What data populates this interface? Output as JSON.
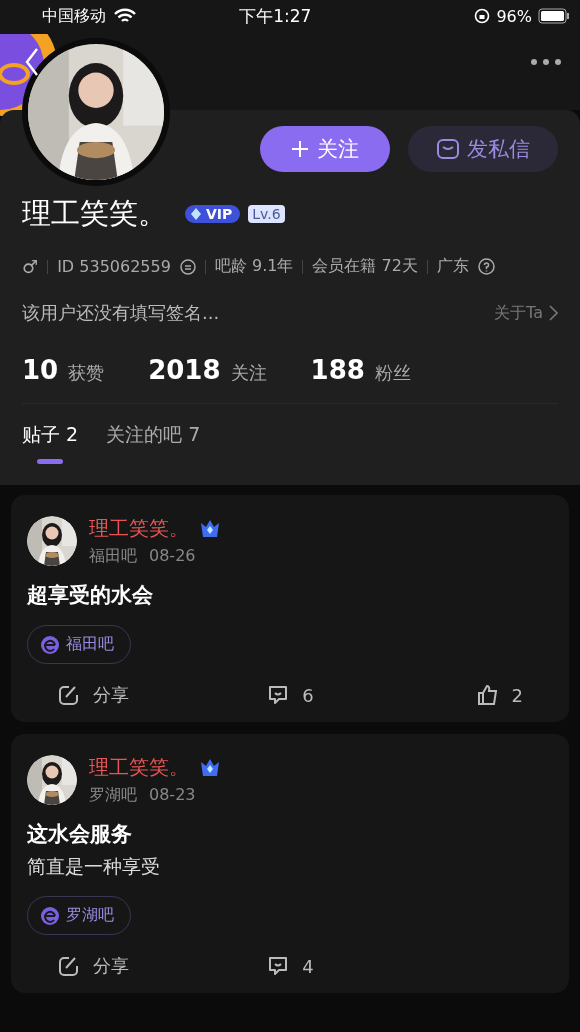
{
  "status_bar": {
    "carrier": "中国移动",
    "time": "下午1:27",
    "battery": "96%"
  },
  "profile": {
    "name": "理工笑笑。",
    "vip": "VIP",
    "level_badge": "Lv.6",
    "follow_button": "关注",
    "message_button": "发私信",
    "gender": "♂",
    "info": [
      "ID 535062559",
      "吧龄 9.1年",
      "会员在籍 72天",
      "广东"
    ],
    "signature": "该用户还没有填写签名...",
    "about_link": "关于Ta"
  },
  "stats": [
    {
      "value": "10",
      "label": "获赞"
    },
    {
      "value": "2018",
      "label": "关注"
    },
    {
      "value": "188",
      "label": "粉丝"
    }
  ],
  "tabs": [
    {
      "label": "贴子",
      "count": "2",
      "selected": true
    },
    {
      "label": "关注的吧",
      "count": "7",
      "selected": false
    }
  ],
  "posts": [
    {
      "author": "理工笑笑。",
      "forum": "福田吧",
      "date": "08-26",
      "title": "超享受的水会",
      "forum_tag": "福田吧",
      "share": "分享",
      "comments": "6",
      "likes": "2"
    },
    {
      "author": "理工笑笑。",
      "forum": "罗湖吧",
      "date": "08-23",
      "title": "这水会服务",
      "body": [
        "简直是一种享受"
      ],
      "forum_tag": "罗湖吧",
      "share": "分享",
      "comments": "4"
    }
  ]
}
